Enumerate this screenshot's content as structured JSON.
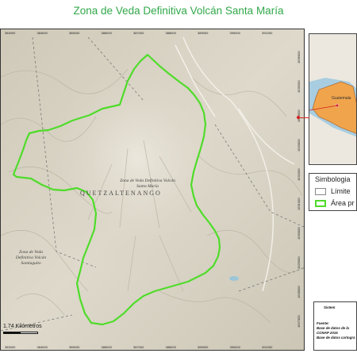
{
  "title": "Zona de Veda Definitiva Volcán Santa María",
  "map": {
    "x_ticks_top": [
      "383000",
      "384000",
      "385000",
      "386000",
      "387000",
      "388000",
      "389000",
      "390000",
      "391000"
    ],
    "x_ticks_bottom": [
      "383000",
      "384000",
      "385000",
      "386000",
      "387000",
      "388000",
      "389000",
      "390000",
      "391000"
    ],
    "y_ticks_right": [
      "1636000",
      "1635000",
      "1634000",
      "1633000",
      "1632000",
      "1631000",
      "1630000",
      "1629000",
      "1628000",
      "1627000"
    ],
    "labels": {
      "zone_main": "Zona de Veda Definitiva Volcán Santa María",
      "city": "QUETZALTENANGO",
      "zone_secondary": "Zona de Veda Definitiva Volcán Santiaguito"
    },
    "scale_label": "1.74 Kilómetros",
    "colors": {
      "boundary": "#4fdc2a",
      "terrain": "#d8d3c4",
      "title": "#32a84a"
    }
  },
  "inset": {
    "label": "Guatemala",
    "colors": {
      "water": "#a8cde0",
      "country": "#f0a44c",
      "neighbors": "#ece8df",
      "marker": "#d62020"
    }
  },
  "legend": {
    "title": "Simbologia",
    "items": [
      {
        "label": "Límite",
        "color": "#e8e8e8"
      },
      {
        "label": "Área pr",
        "color": "#4fdc2a"
      }
    ]
  },
  "info": {
    "heading": "Sistem",
    "source_label": "Fuente:",
    "line1": "Base de datos de la",
    "line2": "CONAP 2016",
    "line3": "Base de datos cartogra"
  }
}
